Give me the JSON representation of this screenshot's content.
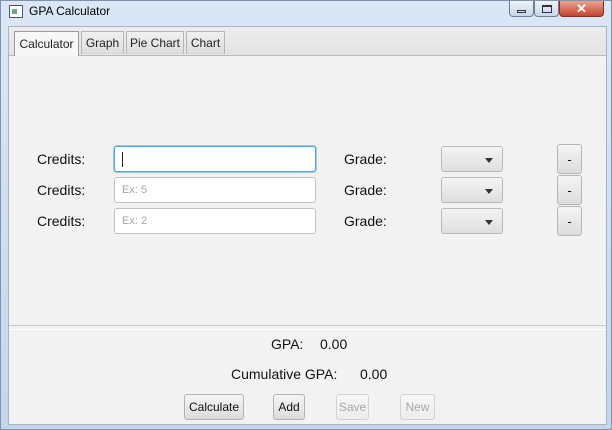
{
  "window": {
    "title": "GPA Calculator"
  },
  "tabs": [
    {
      "label": "Calculator",
      "active": true
    },
    {
      "label": "Graph",
      "active": false
    },
    {
      "label": "Pie Chart",
      "active": false
    },
    {
      "label": "Chart",
      "active": false
    }
  ],
  "rows": [
    {
      "credits_label": "Credits:",
      "credits_value": "",
      "credits_placeholder": "",
      "grade_label": "Grade:",
      "grade_value": "",
      "remove_label": "-"
    },
    {
      "credits_label": "Credits:",
      "credits_value": "",
      "credits_placeholder": "Ex: 5",
      "grade_label": "Grade:",
      "grade_value": "",
      "remove_label": "-"
    },
    {
      "credits_label": "Credits:",
      "credits_value": "",
      "credits_placeholder": "Ex: 2",
      "grade_label": "Grade:",
      "grade_value": "",
      "remove_label": "-"
    }
  ],
  "results": {
    "gpa_label": "GPA:",
    "gpa_value": "0.00",
    "cumulative_label": "Cumulative GPA:",
    "cumulative_value": "0.00"
  },
  "buttons": {
    "calculate": "Calculate",
    "add": "Add",
    "save": "Save",
    "new": "New"
  }
}
